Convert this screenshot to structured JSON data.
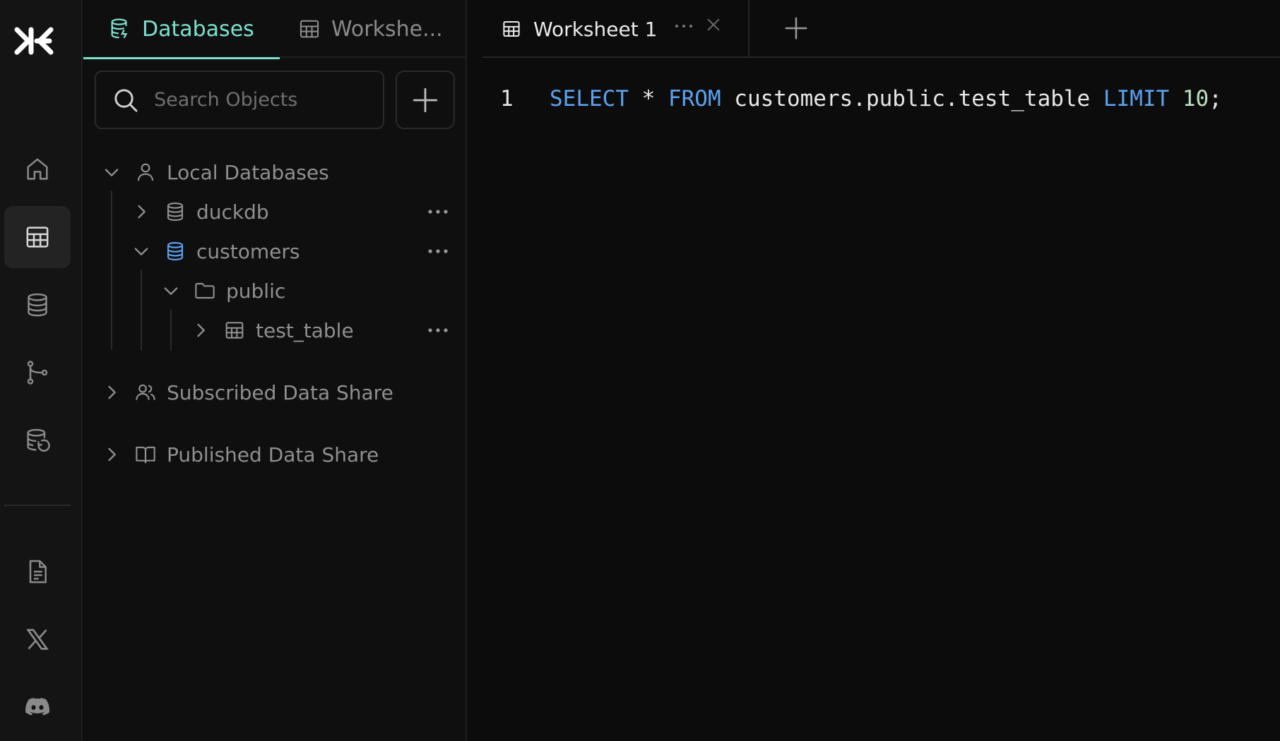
{
  "activity_bar": {
    "logo": "app-logo-icon",
    "items": [
      {
        "icon": "home-icon",
        "active": false
      },
      {
        "icon": "worksheet-grid-icon",
        "active": true
      },
      {
        "icon": "database-icon",
        "active": false
      },
      {
        "icon": "git-branch-icon",
        "active": false
      },
      {
        "icon": "database-history-icon",
        "active": false
      }
    ],
    "bottom_items": [
      {
        "icon": "document-icon"
      },
      {
        "icon": "x-twitter-icon"
      },
      {
        "icon": "discord-icon"
      }
    ]
  },
  "explorer": {
    "tabs": [
      {
        "label": "Databases",
        "icon": "database-stack-icon",
        "active": true
      },
      {
        "label": "Workshe...",
        "icon": "worksheet-grid-icon",
        "active": false
      }
    ],
    "search": {
      "placeholder": "Search Objects",
      "value": ""
    },
    "tree": {
      "local": {
        "label": "Local Databases",
        "expanded": true
      },
      "duckdb": {
        "label": "duckdb",
        "expanded": false
      },
      "customers": {
        "label": "customers",
        "expanded": true
      },
      "public": {
        "label": "public",
        "expanded": true
      },
      "test_table": {
        "label": "test_table",
        "expanded": false
      },
      "subscribed": {
        "label": "Subscribed Data Share",
        "expanded": false
      },
      "published": {
        "label": "Published Data Share",
        "expanded": false
      }
    }
  },
  "editor": {
    "tab": {
      "label": "Worksheet 1"
    },
    "lines": [
      {
        "number": "1",
        "tokens": [
          {
            "text": "SELECT",
            "kind": "kw"
          },
          {
            "text": " * ",
            "kind": "plain"
          },
          {
            "text": "FROM",
            "kind": "kw"
          },
          {
            "text": " customers.public.test_table ",
            "kind": "plain"
          },
          {
            "text": "LIMIT",
            "kind": "kw"
          },
          {
            "text": " ",
            "kind": "plain"
          },
          {
            "text": "10",
            "kind": "num"
          },
          {
            "text": ";",
            "kind": "plain"
          }
        ]
      }
    ]
  },
  "colors": {
    "accent": "#7ce0cf",
    "keyword": "#5aa2f0",
    "number": "#b9e1c2",
    "background": "#0c0c0c"
  }
}
